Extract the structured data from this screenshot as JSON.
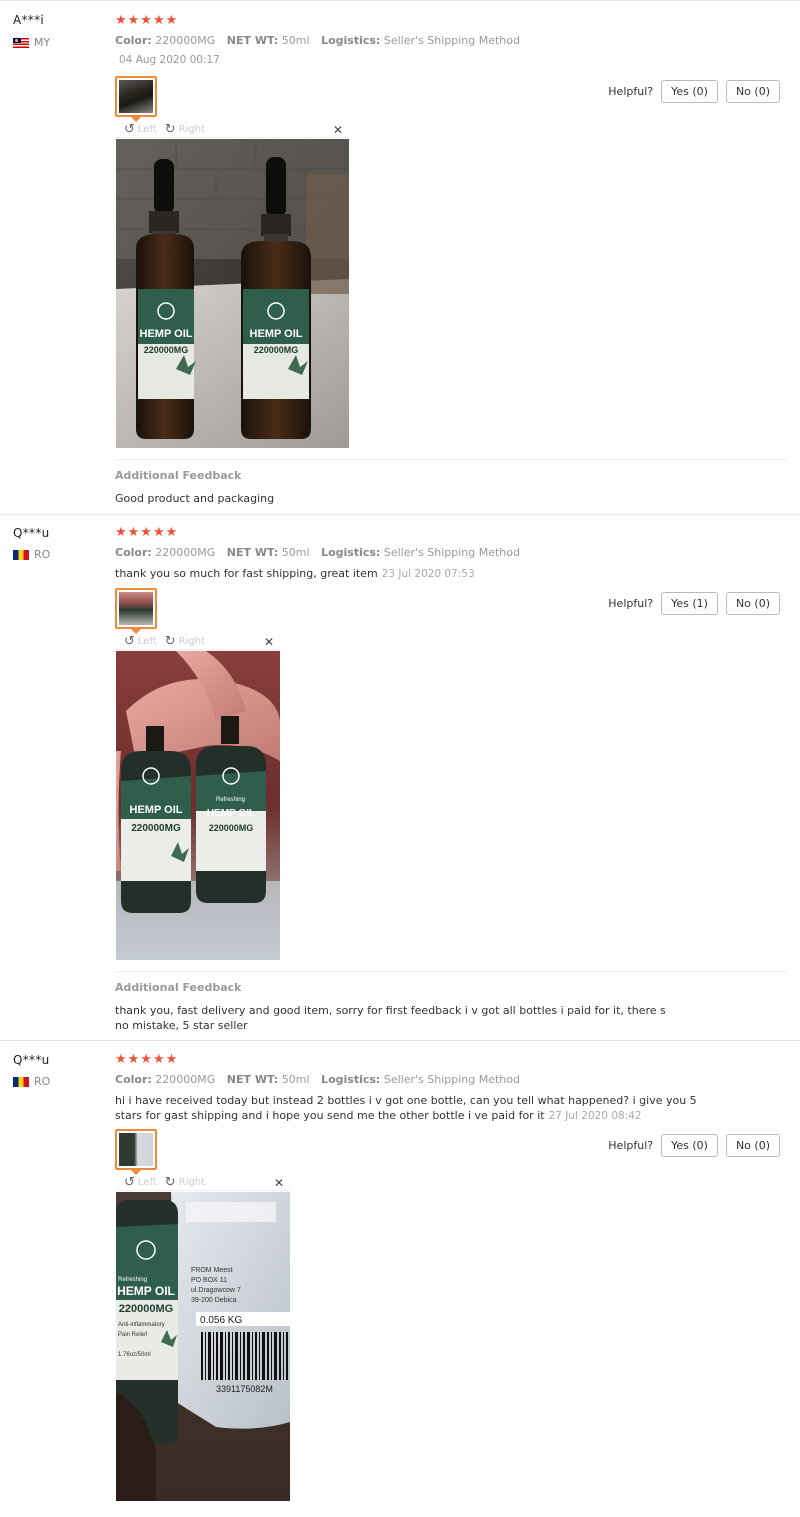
{
  "colors": {
    "star": "#f0523a",
    "thumb_border": "#f08a3a",
    "muted": "#999999"
  },
  "common": {
    "helpful_label": "Helpful?",
    "rotate_left_label": "Left",
    "rotate_right_label": "Right",
    "additional_feedback_title": "Additional Feedback",
    "stars": "★★★★★",
    "color_label": "Color:",
    "netwt_label": "NET WT:",
    "logistics_label": "Logistics:"
  },
  "reviews": [
    {
      "user": "A***i",
      "country": "MY",
      "rating": 5,
      "color": "220000MG",
      "net_wt": "50ml",
      "logistics": "Seller's Shipping Method",
      "text": "",
      "date": "04 Aug 2020 00:17",
      "yes": "Yes (0)",
      "no": "No (0)",
      "additional_feedback": "Good product and packaging"
    },
    {
      "user": "Q***u",
      "country": "RO",
      "rating": 5,
      "color": "220000MG",
      "net_wt": "50ml",
      "logistics": "Seller's Shipping Method",
      "text": "thank you so much for fast shipping, great item",
      "date": "23 Jul 2020 07:53",
      "yes": "Yes (1)",
      "no": "No (0)",
      "additional_feedback": "thank you, fast delivery and good item, sorry for first feedback i v got all bottles i paid for it, there s no mistake, 5 star seller"
    },
    {
      "user": "Q***u",
      "country": "RO",
      "rating": 5,
      "color": "220000MG",
      "net_wt": "50ml",
      "logistics": "Seller's Shipping Method",
      "text": "hi i have received today but instead 2 bottles i v got one bottle, can you tell what happened? i give you 5 stars for gast shipping and i hope you send me the other bottle i ve paid for it",
      "date": "27 Jul 2020 08:42",
      "yes": "Yes (0)",
      "no": "No (0)",
      "additional_feedback": ""
    }
  ],
  "photos": {
    "r1": {
      "label_line1": "HEMP OIL",
      "label_line2": "220000MG"
    },
    "r2": {
      "label_line1": "HEMP OIL",
      "label_line2": "220000MG",
      "brand": "Refreshing"
    },
    "r3": {
      "label_line1": "HEMP OIL",
      "label_line2": "220000MG",
      "brand": "Refreshing",
      "sub": "Anti-inflammatory",
      "sub2": "Pain Relief",
      "size": "1.76oz/50ml",
      "parcel_weight": "0.056 KG",
      "parcel_from": "FROM Meest",
      "parcel_box": "PO BOX 11",
      "parcel_street": "ul.Dragowcow 7",
      "parcel_city": "39-200 Debica",
      "barcode_text": "3391175082M"
    }
  }
}
